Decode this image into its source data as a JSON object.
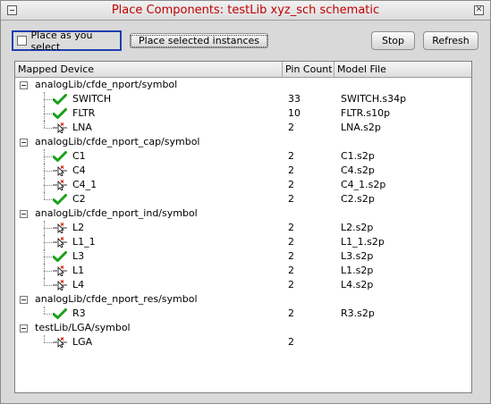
{
  "window": {
    "title": "Place Components: testLib xyz_sch schematic",
    "close_glyph": "✕"
  },
  "toolbar": {
    "place_as_you_select_label": "Place as you select",
    "place_selected_label": "Place selected instances",
    "stop_label": "Stop",
    "refresh_label": "Refresh"
  },
  "table": {
    "columns": [
      "Mapped Device",
      "Pin Count",
      "Model File"
    ],
    "groups": [
      {
        "name": "analogLib/cfde_nport/symbol",
        "items": [
          {
            "name": "SWITCH",
            "pins": "33",
            "model": "SWITCH.s34p",
            "status": "check"
          },
          {
            "name": "FLTR",
            "pins": "10",
            "model": "FLTR.s10p",
            "status": "check"
          },
          {
            "name": "LNA",
            "pins": "2",
            "model": "LNA.s2p",
            "status": "place"
          }
        ]
      },
      {
        "name": "analogLib/cfde_nport_cap/symbol",
        "items": [
          {
            "name": "C1",
            "pins": "2",
            "model": "C1.s2p",
            "status": "check"
          },
          {
            "name": "C4",
            "pins": "2",
            "model": "C4.s2p",
            "status": "place"
          },
          {
            "name": "C4_1",
            "pins": "2",
            "model": "C4_1.s2p",
            "status": "place"
          },
          {
            "name": "C2",
            "pins": "2",
            "model": "C2.s2p",
            "status": "check"
          }
        ]
      },
      {
        "name": "analogLib/cfde_nport_ind/symbol",
        "items": [
          {
            "name": "L2",
            "pins": "2",
            "model": "L2.s2p",
            "status": "place"
          },
          {
            "name": "L1_1",
            "pins": "2",
            "model": "L1_1.s2p",
            "status": "place"
          },
          {
            "name": "L3",
            "pins": "2",
            "model": "L3.s2p",
            "status": "check"
          },
          {
            "name": "L1",
            "pins": "2",
            "model": "L1.s2p",
            "status": "place"
          },
          {
            "name": "L4",
            "pins": "2",
            "model": "L4.s2p",
            "status": "place"
          }
        ]
      },
      {
        "name": "analogLib/cfde_nport_res/symbol",
        "items": [
          {
            "name": "R3",
            "pins": "2",
            "model": "R3.s2p",
            "status": "check"
          }
        ]
      },
      {
        "name": "testLib/LGA/symbol",
        "items": [
          {
            "name": "LGA",
            "pins": "2",
            "model": "",
            "status": "place"
          }
        ]
      }
    ]
  },
  "icons": {
    "check": "check-icon",
    "place": "place-instance-icon"
  },
  "colors": {
    "title": "#c00000",
    "focus_border": "#1e3fb0",
    "check": "#1aa01a",
    "place": "#cc2200"
  }
}
